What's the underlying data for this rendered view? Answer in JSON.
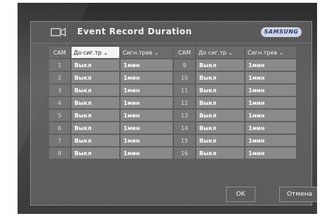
{
  "dialog": {
    "title": "Event Record Duration",
    "brand": "SAMSUNG"
  },
  "table": {
    "headers": [
      "CAM",
      "До сиг.тр",
      "Сигн.трев",
      "CAM",
      "До сиг.тр",
      "Сигн.трев"
    ],
    "rows": [
      [
        "1",
        "Выкл",
        "1мин",
        "9",
        "Выкл",
        "1мин"
      ],
      [
        "2",
        "Выкл",
        "1мин",
        "10",
        "Выкл",
        "1мин"
      ],
      [
        "3",
        "Выкл",
        "1мин",
        "11",
        "Выкл",
        "1мин"
      ],
      [
        "4",
        "Выкл",
        "1мин",
        "12",
        "Выкл",
        "1мин"
      ],
      [
        "5",
        "Выкл",
        "1мин",
        "13",
        "Выкл",
        "1мин"
      ],
      [
        "6",
        "Выкл",
        "1мин",
        "14",
        "Выкл",
        "1мин"
      ],
      [
        "7",
        "Выкл",
        "1мин",
        "15",
        "Выкл",
        "1мин"
      ],
      [
        "8",
        "Выкл",
        "1мин",
        "16",
        "Выкл",
        "1мин"
      ]
    ]
  },
  "buttons": {
    "ok": "OK",
    "cancel": "Отмена"
  }
}
